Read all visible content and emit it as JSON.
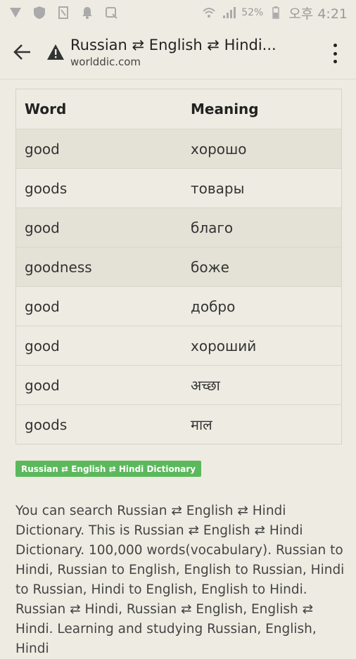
{
  "status_bar": {
    "battery_pct": "52%",
    "time": "오후 4:21"
  },
  "app_bar": {
    "title": "Russian ⇄ English ⇄ Hindi...",
    "url": "worlddic.com"
  },
  "table": {
    "headers": [
      "Word",
      "Meaning"
    ],
    "rows": [
      {
        "word": "good",
        "meaning": "хорошо"
      },
      {
        "word": "goods",
        "meaning": "товары"
      },
      {
        "word": "good",
        "meaning": "благо"
      },
      {
        "word": "goodness",
        "meaning": "боже"
      },
      {
        "word": "good",
        "meaning": "добро"
      },
      {
        "word": "good",
        "meaning": "хороший"
      },
      {
        "word": "good",
        "meaning": "अच्छा"
      },
      {
        "word": "goods",
        "meaning": "माल"
      }
    ]
  },
  "tag": "Russian ⇄ English ⇄ Hindi Dictionary",
  "description": "You can search Russian ⇄ English ⇄ Hindi Dictionary. This is Russian ⇄ English ⇄ Hindi Dictionary. 100,000 words(vocabulary). Russian to Hindi, Russian to English, English to Russian, Hindi to Russian, Hindi to English, English to Hindi. Russian ⇄ Hindi, Russian ⇄ English, English ⇄ Hindi. Learning and studying Russian, English, Hindi",
  "colors": {
    "background": "#eeece2",
    "tag_green": "#5cb85c",
    "row_shade": "#e4e2d6"
  }
}
